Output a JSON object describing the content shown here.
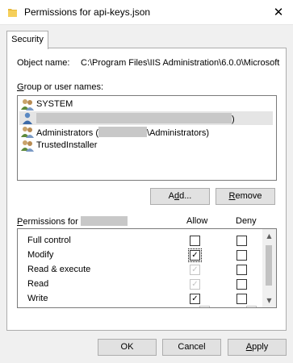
{
  "window": {
    "title": "Permissions for api-keys.json",
    "close_glyph": "✕",
    "icon": "folder-icon"
  },
  "tabs": [
    {
      "label": "Security",
      "active": true
    }
  ],
  "object": {
    "label": "Object name:",
    "value": "C:\\Program Files\\IIS Administration\\6.0.0\\Microsoft"
  },
  "users": {
    "label_hotkey": "G",
    "label_rest": "roup or user names:",
    "items": [
      {
        "prefix": "SYSTEM",
        "redacted": false,
        "suffix": "",
        "icon": "group-users-icon"
      },
      {
        "prefix": "",
        "redacted": true,
        "suffix": ")",
        "icon": "single-user-icon",
        "selected": true
      },
      {
        "prefix": "Administrators (",
        "redacted": true,
        "suffix": "\\Administrators)",
        "icon": "group-users-icon"
      },
      {
        "prefix": "TrustedInstaller",
        "redacted": false,
        "suffix": "",
        "icon": "group-users-icon"
      }
    ]
  },
  "buttons": {
    "add_pre": "A",
    "add_hotkey": "d",
    "add_post": "d...",
    "remove_hotkey": "R",
    "remove_post": "emove",
    "ok": "OK",
    "cancel": "Cancel",
    "apply_hotkey": "A",
    "apply_post": "pply"
  },
  "permissions": {
    "label_hotkey": "P",
    "label_rest": "ermissions for",
    "allow_header": "Allow",
    "deny_header": "Deny",
    "rows": [
      {
        "name": "Full control",
        "allow": "unchecked",
        "deny": "unchecked"
      },
      {
        "name": "Modify",
        "allow": "checked-focus",
        "deny": "unchecked"
      },
      {
        "name": "Read & execute",
        "allow": "checked-disabled",
        "deny": "unchecked"
      },
      {
        "name": "Read",
        "allow": "checked-disabled",
        "deny": "unchecked"
      },
      {
        "name": "Write",
        "allow": "checked",
        "deny": "unchecked"
      }
    ]
  },
  "colors": {
    "accent": "#0078d7",
    "window_bg": "#f0f0f0",
    "redaction": "#c8c8c8",
    "selection": "#e5e5e5"
  }
}
